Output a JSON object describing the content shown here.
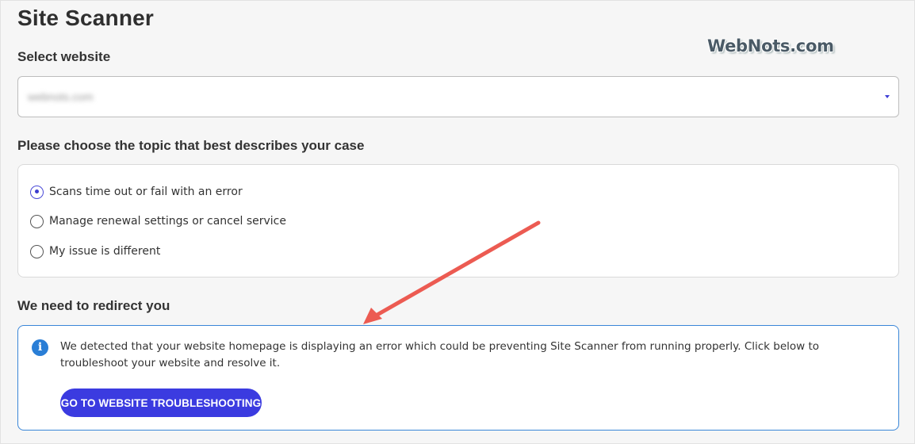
{
  "page": {
    "title": "Site Scanner",
    "watermark": "WebNots.com"
  },
  "website": {
    "label": "Select website",
    "selected_value": "webnots.com"
  },
  "topic": {
    "label": "Please choose the topic that best describes your case",
    "options": [
      {
        "label": "Scans time out or fail with an error",
        "checked": true
      },
      {
        "label": "Manage renewal settings or cancel service",
        "checked": false
      },
      {
        "label": "My issue is different",
        "checked": false
      }
    ]
  },
  "redirect": {
    "label": "We need to redirect you",
    "icon": "info-icon",
    "message": "We detected that your website homepage is displaying an error which could be preventing Site Scanner from running properly. Click below to troubleshoot your website and resolve it.",
    "button_label": "GO TO WEBSITE TROUBLESHOOTING"
  },
  "colors": {
    "accent": "#3b3be0",
    "info_border": "#3a86d8",
    "annotation_arrow": "#ec5b52"
  }
}
